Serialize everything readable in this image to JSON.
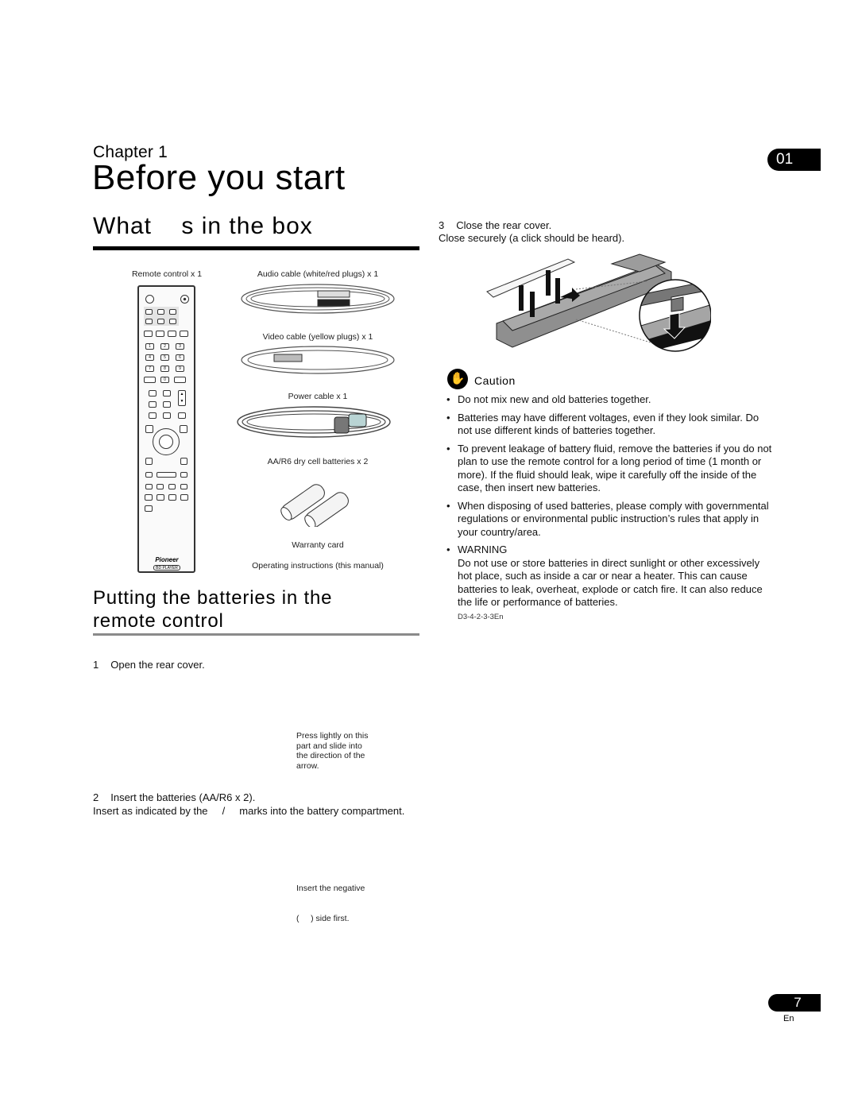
{
  "header": {
    "chapter_label": "Chapter 1",
    "page_title": "Before you start",
    "chapter_tab": "01"
  },
  "section_box": {
    "heading": "What    s in the box",
    "items": [
      {
        "label": "Remote control x 1"
      },
      {
        "label": "Audio cable (white/red plugs) x 1"
      },
      {
        "label": "Video cable (yellow plugs) x 1"
      },
      {
        "label": "Power cable x 1"
      },
      {
        "label": "AA/R6 dry cell batteries x 2"
      },
      {
        "label": "Warranty card"
      },
      {
        "label": "Operating instructions (this manual)"
      }
    ],
    "remote": {
      "brand": "Pioneer",
      "badge": "BD PLAYER",
      "number_keys": [
        "1",
        "2",
        "3",
        "4",
        "5",
        "6",
        "7",
        "8",
        "9",
        "0"
      ],
      "up_arrow": "▲",
      "down_arrow": "▼"
    }
  },
  "section_batteries": {
    "heading": "Putting the batteries in the remote control",
    "step1": {
      "number": "1",
      "text": "Open the rear cover."
    },
    "step1_note": [
      "Press lightly on this",
      "part and slide into",
      "the direction of the",
      "arrow."
    ],
    "step2": {
      "number": "2",
      "text": "Insert the batteries (AA/R6 x 2)."
    },
    "step2_detail": "Insert as indicated by the     /     marks into the battery compartment.",
    "step2_note": [
      "Insert the negative",
      "(     ) side first."
    ],
    "step3": {
      "number": "3",
      "text": "Close the rear cover."
    },
    "step3_detail": "Close securely (a click should be heard)."
  },
  "caution": {
    "label": "Caution",
    "bullets": [
      "Do not mix new and old batteries together.",
      "Batteries may have different voltages, even if they look similar. Do not use different kinds of batteries together.",
      "To prevent leakage of battery fluid, remove the batteries if you do not plan to use the remote control for a long period of time (1 month or more). If the fluid should leak, wipe it carefully off the inside of the case, then insert new batteries.",
      "When disposing of used batteries, please comply with governmental regulations or environmental public instruction’s rules that apply in your country/area."
    ],
    "warning_title": "WARNING",
    "warning_text": "Do not use or store batteries in direct sunlight or other excessively hot place, such as inside a car or near a heater. This can cause batteries to leak, overheat, explode or catch fire. It can also reduce the life or performance of batteries.",
    "code": "D3-4-2-3-3En"
  },
  "footer": {
    "page_number": "7",
    "language": "En"
  }
}
